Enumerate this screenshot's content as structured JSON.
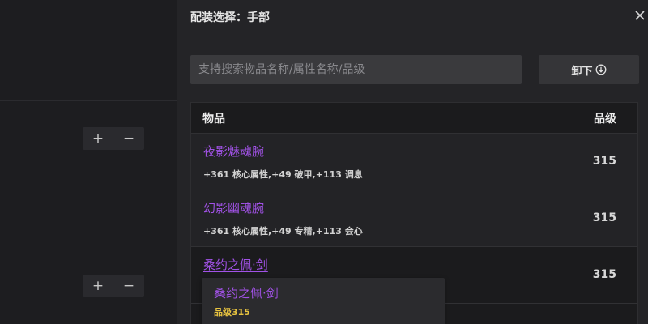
{
  "drawer": {
    "title": "配装选择：手部",
    "search_placeholder": "支持搜索物品名称/属性名称/品级",
    "unequip_label": "卸下"
  },
  "table": {
    "col_item": "物品",
    "col_level": "品级",
    "rows": [
      {
        "name": "夜影魅魂腕",
        "attrs": "+361 核心属性,+49 破甲,+113 调息",
        "level": "315"
      },
      {
        "name": "幻影幽魂腕",
        "attrs": "+361 核心属性,+49 专精,+113 会心",
        "level": "315"
      },
      {
        "name": "桑约之佩·剑",
        "attrs": "",
        "level": "315"
      }
    ]
  },
  "tooltip": {
    "name": "桑约之佩·剑",
    "level_text": "品级315"
  },
  "background": {
    "stepper_plus": "+",
    "stepper_minus": "−"
  },
  "colors": {
    "item_purple": "#a152e6",
    "level_yellow": "#e8c440"
  },
  "icons": [
    "close-icon",
    "arrow-down-circle-icon"
  ]
}
